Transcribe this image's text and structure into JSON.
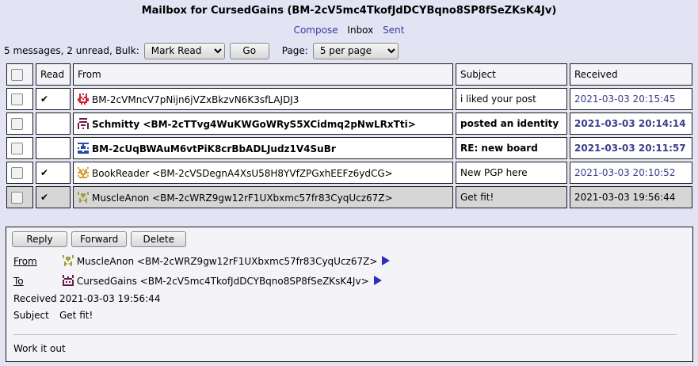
{
  "header": {
    "title": "Mailbox for CursedGains (BM-2cV5mc4TkofJdDCYBqno8SP8fSeZKsK4Jv)",
    "nav": {
      "compose": "Compose",
      "inbox": "Inbox",
      "sent": "Sent"
    }
  },
  "toolbar": {
    "summary": "5 messages, 2 unread, Bulk:",
    "bulk_selected": "Mark Read",
    "go_label": "Go",
    "page_label": "Page:",
    "page_selected": "5 per page"
  },
  "table": {
    "columns": {
      "read": "Read",
      "from": "From",
      "subject": "Subject",
      "received": "Received"
    },
    "rows": [
      {
        "read": "✔",
        "from": "BM-2cVMncV7pNijn6jVZxBkzvN6K3sfLAJDJ3",
        "subject": "i liked your post",
        "received": "2021-03-03 20:15:45",
        "unread": false,
        "identicon": "red",
        "selected": false
      },
      {
        "read": "",
        "from": "Schmitty <BM-2cTTvg4WuKWGoWRyS5XCidmq2pNwLRxTti>",
        "subject": "posted an identity",
        "received": "2021-03-03 20:14:14",
        "unread": true,
        "identicon": "maroon",
        "selected": false
      },
      {
        "read": "",
        "from": "BM-2cUqBWAuM6vtPiK8crBbADLJudz1V4SuBr",
        "subject": "RE: new board",
        "received": "2021-03-03 20:11:57",
        "unread": true,
        "identicon": "blue",
        "selected": false
      },
      {
        "read": "✔",
        "from": "BookReader <BM-2cVSDegnA4XsU58H8YVfZPGxhEEFz6ydCG>",
        "subject": "New PGP here",
        "received": "2021-03-03 20:10:52",
        "unread": false,
        "identicon": "gold",
        "selected": false
      },
      {
        "read": "✔",
        "from": "MuscleAnon <BM-2cWRZ9gw12rF1UXbxmc57fr83CyqUcz67Z>",
        "subject": "Get fit!",
        "received": "2021-03-03 19:56:44",
        "unread": false,
        "identicon": "olive",
        "selected": true
      }
    ]
  },
  "message": {
    "buttons": {
      "reply": "Reply",
      "forward": "Forward",
      "delete": "Delete"
    },
    "labels": {
      "from": "From",
      "to": "To",
      "received": "Received",
      "subject": "Subject"
    },
    "from": "MuscleAnon <BM-2cWRZ9gw12rF1UXbxmc57fr83CyqUcz67Z>",
    "to": "CursedGains <BM-2cV5mc4TkofJdDCYBqno8SP8fSeZKsK4Jv>",
    "received": "2021-03-03 19:56:44",
    "subject": "Get fit!",
    "body": "Work it out"
  },
  "colors": {
    "background": "#e2e4f4",
    "link": "#3a3aa6",
    "date": "#3c3c8a",
    "arrow": "#2d2dbf",
    "identicons": {
      "red": "#d02030",
      "maroon": "#6a1a4a",
      "blue": "#2a4aa8",
      "gold": "#d8a030",
      "olive": "#a0a040"
    }
  }
}
